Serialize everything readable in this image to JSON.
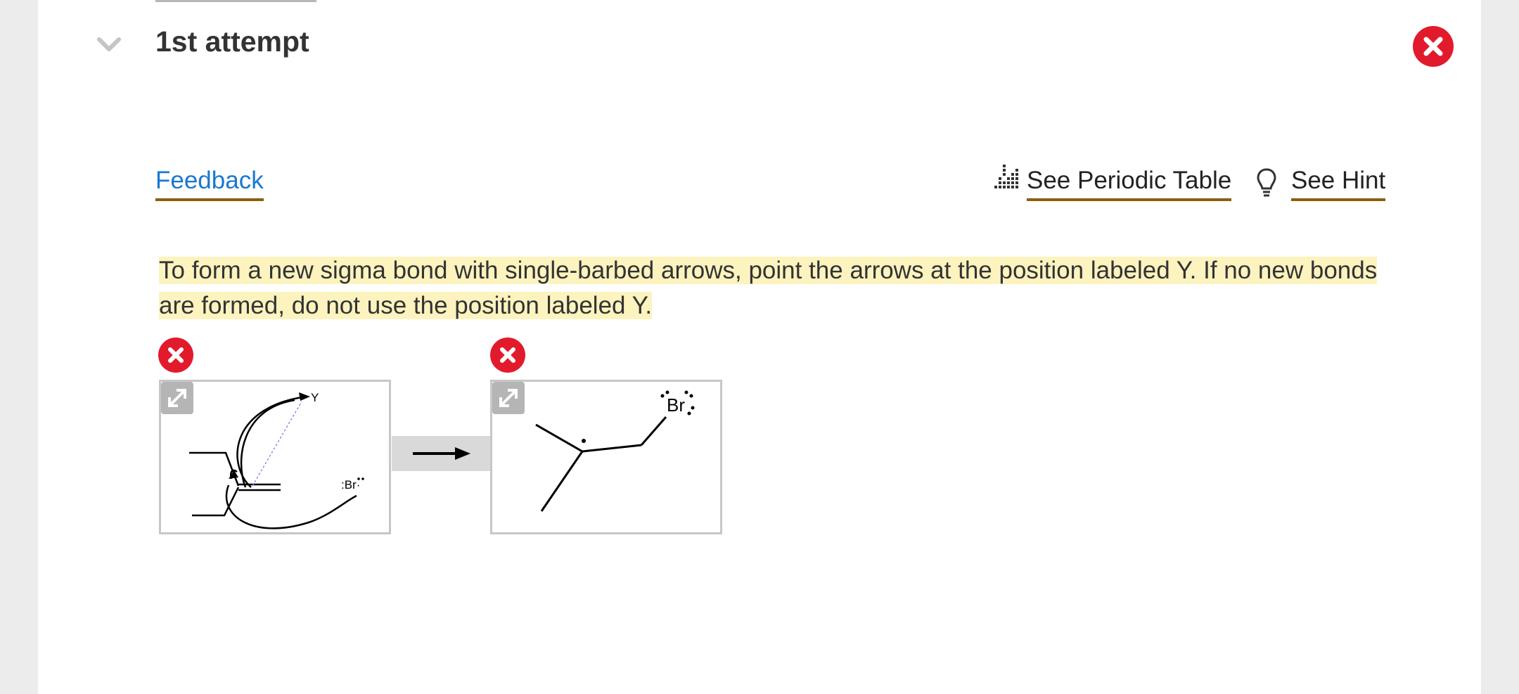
{
  "attempt": {
    "title": "1st attempt"
  },
  "links": {
    "feedback": "Feedback",
    "periodic_table": "See Periodic Table",
    "hint": "See Hint"
  },
  "feedback_message": "To form a new sigma bond with single-barbed arrows, point the arrows at the position labeled Y. If no new bonds are formed, do not use the position labeled Y.",
  "reactant": {
    "y_label": "Y",
    "br_label": ":Br·"
  },
  "product": {
    "br_label": "Br"
  },
  "colors": {
    "error_red": "#e21b2c",
    "link_blue": "#1a78d2",
    "underline_brown": "#8c5f0e",
    "highlight_yellow": "#fdf3bf"
  },
  "icons": [
    "chevron-down-icon",
    "close-icon",
    "periodic-table-icon",
    "lightbulb-icon",
    "error-icon",
    "info-icon",
    "expand-icon",
    "arrow-right-icon"
  ]
}
